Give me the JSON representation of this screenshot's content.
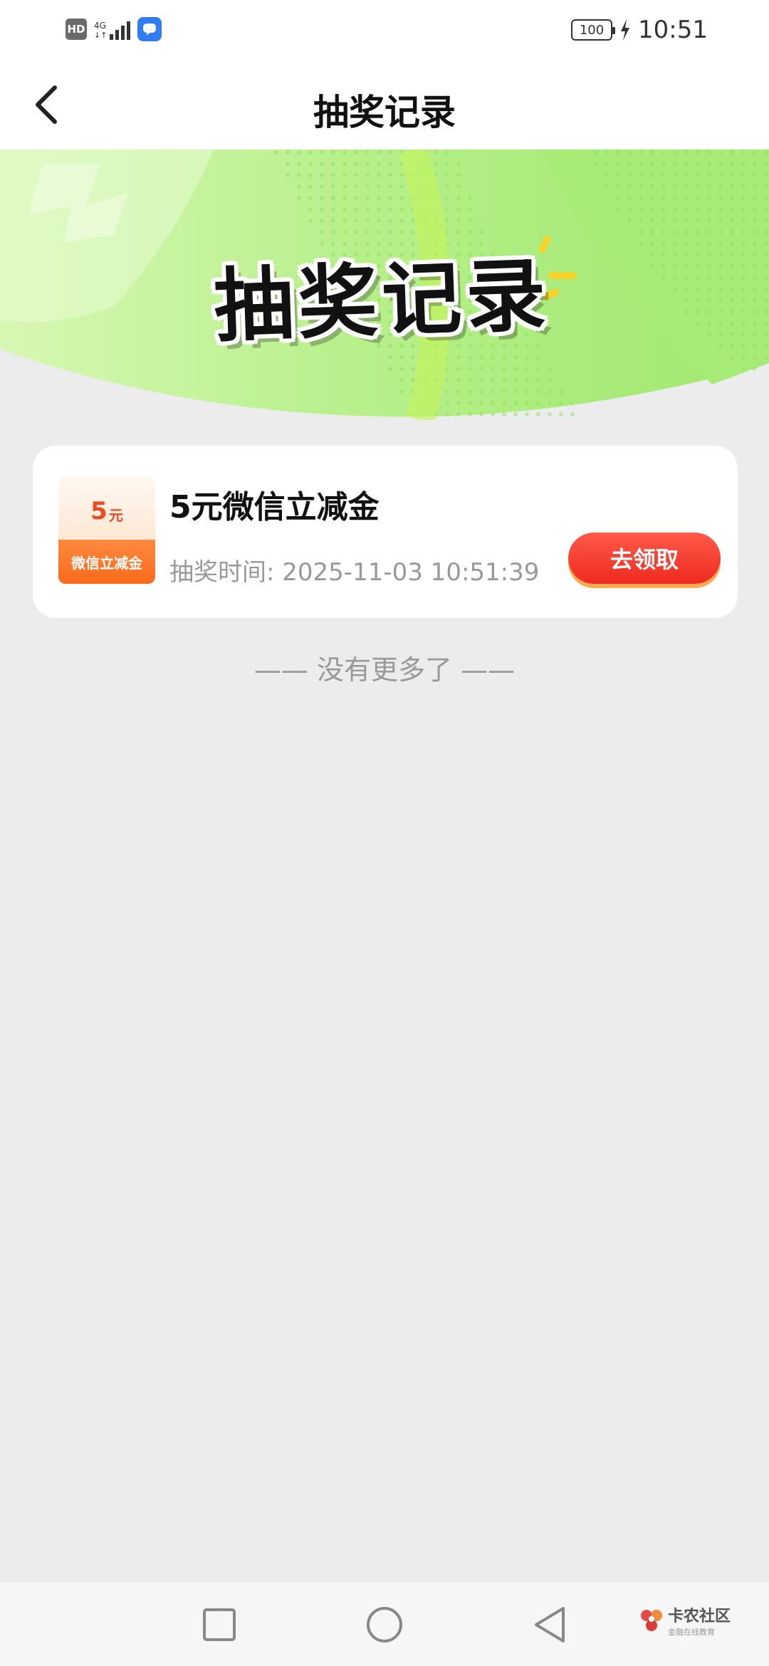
{
  "status_bar": {
    "hd_label": "HD",
    "network_label": "4G",
    "battery_level": "100",
    "time": "10:51",
    "icons": [
      "hd-icon",
      "signal-icon",
      "chat-app-icon",
      "battery-icon",
      "charging-icon"
    ]
  },
  "header": {
    "title": "抽奖记录",
    "back_icon": "chevron-left-icon"
  },
  "banner": {
    "title": "抽奖记录",
    "colors": {
      "light_green": "#c8f59a",
      "mid_green": "#a6ec7a",
      "accent_yellow": "#f6d32a"
    }
  },
  "records": [
    {
      "thumb_amount": "5",
      "thumb_unit": "元",
      "thumb_label": "微信立减金",
      "prize_name": "5元微信立减金",
      "draw_time_label": "抽奖时间:",
      "draw_time": "2025-11-03 10:51:39",
      "claim_label": "去领取"
    }
  ],
  "footer_text": "—— 没有更多了 ——",
  "nav": {
    "icons": [
      "recent-apps-icon",
      "home-icon",
      "back-icon"
    ]
  },
  "watermark": {
    "main": "卡农社区",
    "sub": "金融在线教育"
  },
  "colors": {
    "page_bg": "#ececec",
    "accent_red": "#ee2a1f",
    "accent_orange": "#f76a1c"
  }
}
